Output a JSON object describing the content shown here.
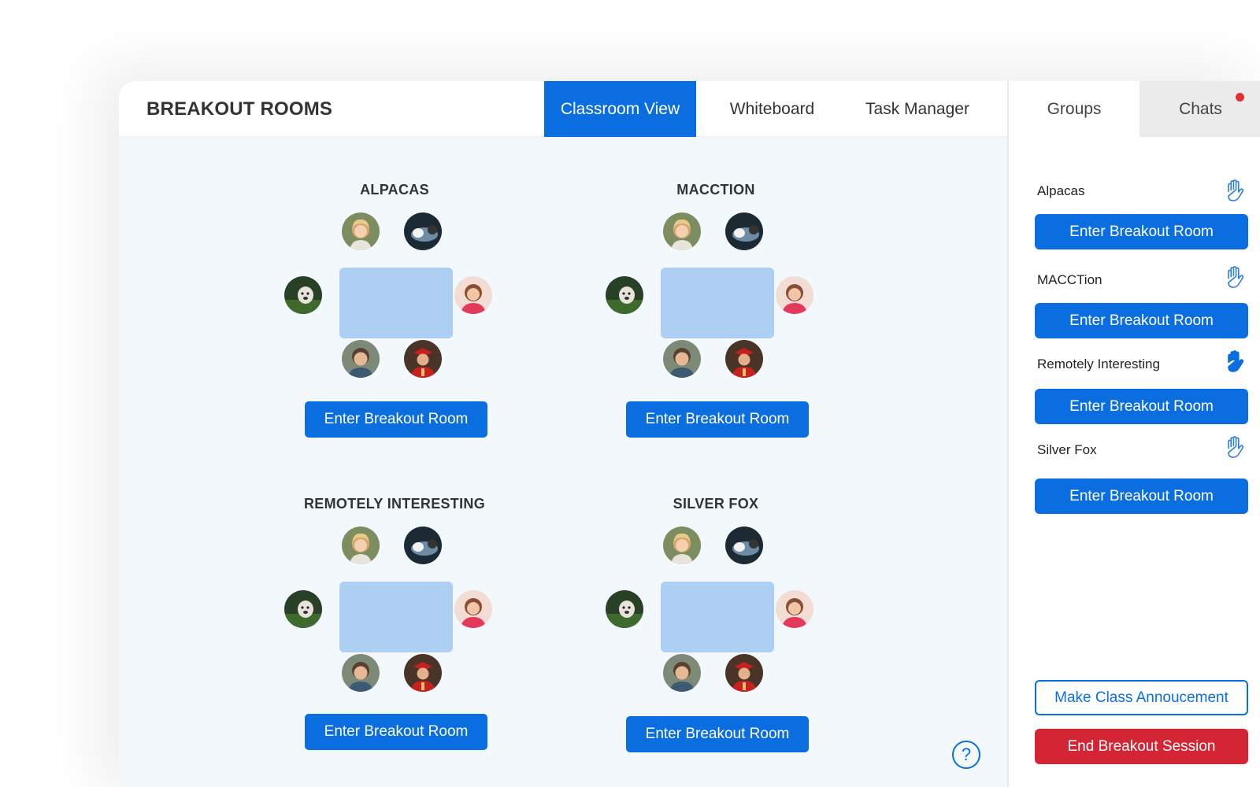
{
  "header": {
    "title": "BREAKOUT ROOMS",
    "tabs": [
      {
        "label": "Classroom View",
        "active": true
      },
      {
        "label": "Whiteboard",
        "active": false
      },
      {
        "label": "Task Manager",
        "active": false
      }
    ]
  },
  "sidebar": {
    "tabs": [
      {
        "label": "Groups",
        "active": true
      },
      {
        "label": "Chats",
        "active": false,
        "has_notification": true
      }
    ],
    "groups": [
      {
        "name": "Alpacas",
        "button_label": "Enter Breakout Room",
        "icon": "raise-hand-icon",
        "hand_raised": false
      },
      {
        "name": "MACCTion",
        "button_label": "Enter Breakout Room",
        "icon": "raise-hand-icon",
        "hand_raised": false
      },
      {
        "name": "Remotely Interesting",
        "button_label": "Enter Breakout Room",
        "icon": "raise-hand-icon",
        "hand_raised": true
      },
      {
        "name": "Silver Fox",
        "button_label": "Enter Breakout Room",
        "icon": "raise-hand-icon",
        "hand_raised": false
      }
    ],
    "announce_label": "Make Class Annoucement",
    "end_label": "End Breakout Session"
  },
  "rooms": [
    {
      "title": "ALPACAS",
      "button_label": "Enter Breakout Room"
    },
    {
      "title": "MACCTION",
      "button_label": "Enter Breakout Room"
    },
    {
      "title": "REMOTELY INTERESTING",
      "button_label": "Enter Breakout Room"
    },
    {
      "title": "SILVER FOX",
      "button_label": "Enter Breakout Room"
    }
  ],
  "help": {
    "label": "?",
    "icon": "help-icon"
  },
  "colors": {
    "primary": "#0b6ee0",
    "danger": "#d42535",
    "table": "#aecff4",
    "canvas": "#f2f8fc",
    "notification": "#e0312f"
  }
}
